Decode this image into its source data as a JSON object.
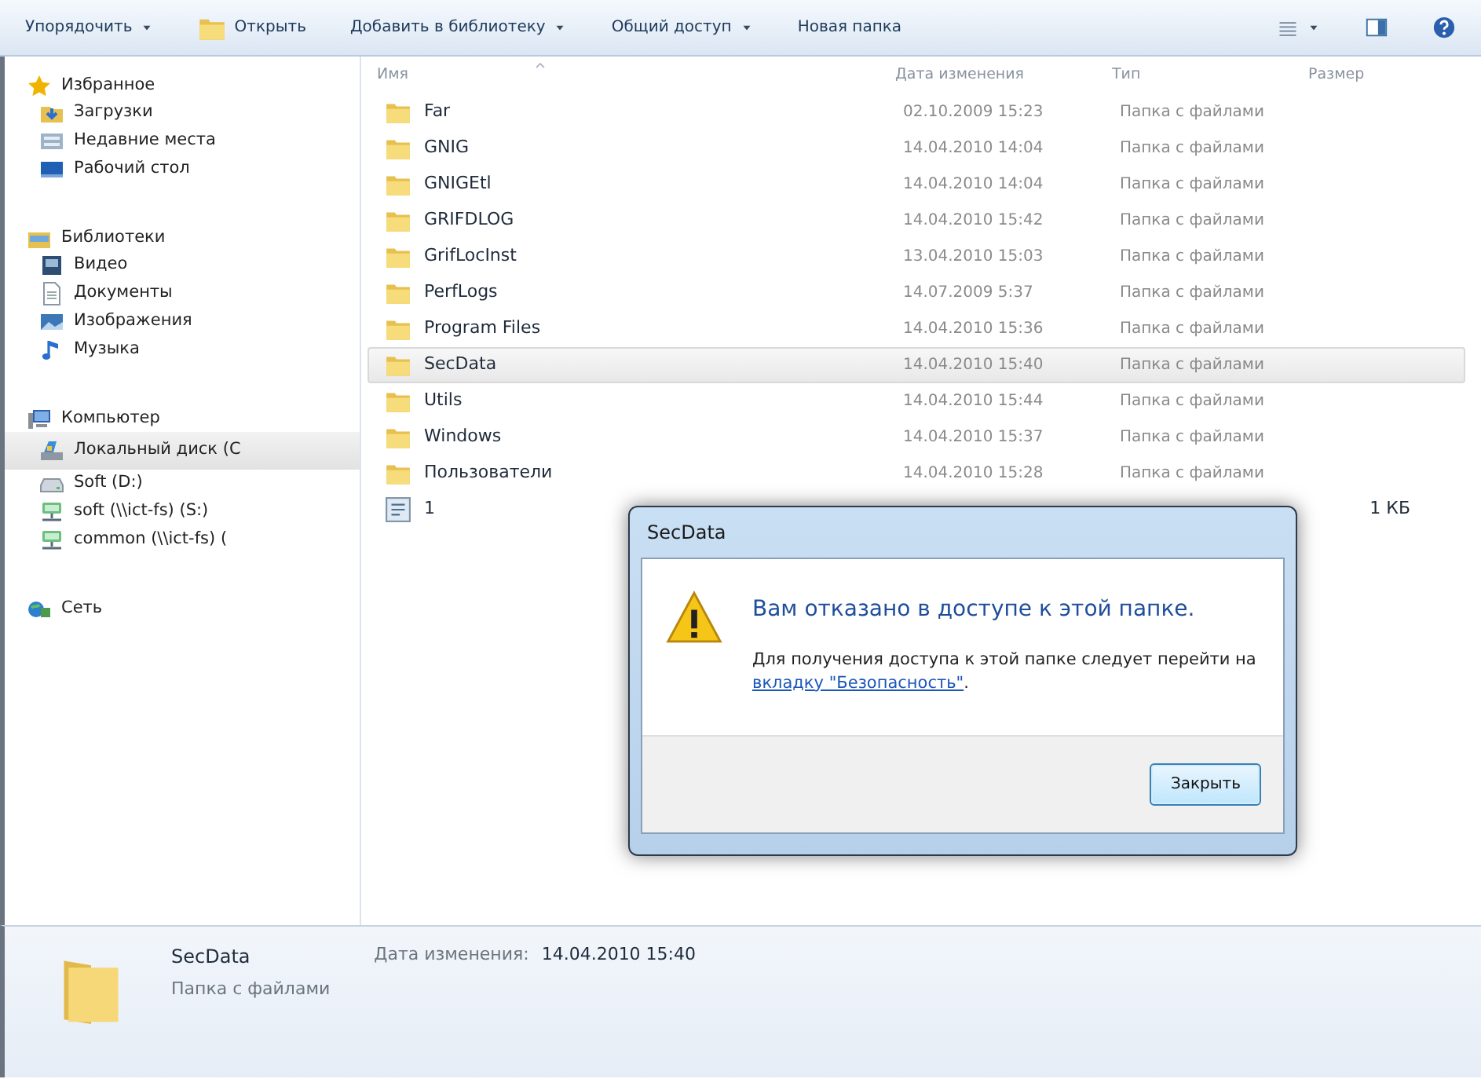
{
  "toolbar": [
    {
      "label": "Упорядочить",
      "dropdown": true
    },
    {
      "label": "Открыть",
      "dropdown": false
    },
    {
      "label": "Добавить в библиотеку",
      "dropdown": true
    },
    {
      "label": "Общий доступ",
      "dropdown": true
    },
    {
      "label": "Новая папка",
      "dropdown": false
    }
  ],
  "sidebar": {
    "groups": [
      {
        "label": "Избранное",
        "items": [
          {
            "label": "Загрузки",
            "selected": false
          },
          {
            "label": "Недавние места",
            "selected": false
          },
          {
            "label": "Рабочий стол",
            "selected": false
          }
        ]
      },
      {
        "label": "Библиотеки",
        "items": [
          {
            "label": "Видео",
            "selected": false
          },
          {
            "label": "Документы",
            "selected": false
          },
          {
            "label": "Изображения",
            "selected": false
          },
          {
            "label": "Музыка",
            "selected": false
          }
        ]
      },
      {
        "label": "Компьютер",
        "items": [
          {
            "label": "Локальный диск (C",
            "selected": true
          },
          {
            "label": "Soft (D:)",
            "selected": false
          },
          {
            "label": "soft (\\\\ict-fs) (S:)",
            "selected": false
          },
          {
            "label": "common (\\\\ict-fs) (",
            "selected": false
          }
        ]
      },
      {
        "label": "Сеть"
      }
    ]
  },
  "table": {
    "columns": [
      "Имя",
      "Дата изменения",
      "Тип",
      "Размер"
    ],
    "rows": [
      {
        "kind": "folder",
        "name": "Far",
        "date": "02.10.2009 15:23",
        "type": "Папка с файлами",
        "selected": false
      },
      {
        "kind": "folder",
        "name": "GNIG",
        "date": "14.04.2010 14:04",
        "type": "Папка с файлами",
        "selected": false
      },
      {
        "kind": "folder",
        "name": "GNIGEtl",
        "date": "14.04.2010 14:04",
        "type": "Папка с файлами",
        "selected": false
      },
      {
        "kind": "folder",
        "name": "GRIFDLOG",
        "date": "14.04.2010 15:42",
        "type": "Папка с файлами",
        "selected": false
      },
      {
        "kind": "folder",
        "name": "GrifLocInst",
        "date": "13.04.2010 15:03",
        "type": "Папка с файлами",
        "selected": false
      },
      {
        "kind": "folder",
        "name": "PerfLogs",
        "date": "14.07.2009 5:37",
        "type": "Папка с файлами",
        "selected": false
      },
      {
        "kind": "folder",
        "name": "Program Files",
        "date": "14.04.2010 15:36",
        "type": "Папка с файлами",
        "selected": false
      },
      {
        "kind": "folder",
        "name": "SecData",
        "date": "14.04.2010 15:40",
        "type": "Папка с файлами",
        "selected": true
      },
      {
        "kind": "folder",
        "name": "Utils",
        "date": "14.04.2010 15:44",
        "type": "Папка с файлами",
        "selected": false
      },
      {
        "kind": "folder",
        "name": "Windows",
        "date": "14.04.2010 15:37",
        "type": "Папка с файлами",
        "selected": false
      },
      {
        "kind": "folder",
        "name": "Пользователи",
        "date": "14.04.2010 15:28",
        "type": "Папка с файлами",
        "selected": false
      },
      {
        "kind": "file",
        "name": "1",
        "size": "1 КБ",
        "selected": false
      }
    ]
  },
  "details": {
    "name": "SecData",
    "type": "Папка с файлами",
    "date_label": "Дата изменения:",
    "date": "14.04.2010 15:40"
  },
  "dialog": {
    "title": "SecData",
    "heading": "Вам отказано в доступе к этой папке.",
    "message": "Для получения доступа к этой папке следует перейти на",
    "link": "вкладку \"Безопасность\"",
    "message_end": ".",
    "button": "Закрыть"
  }
}
